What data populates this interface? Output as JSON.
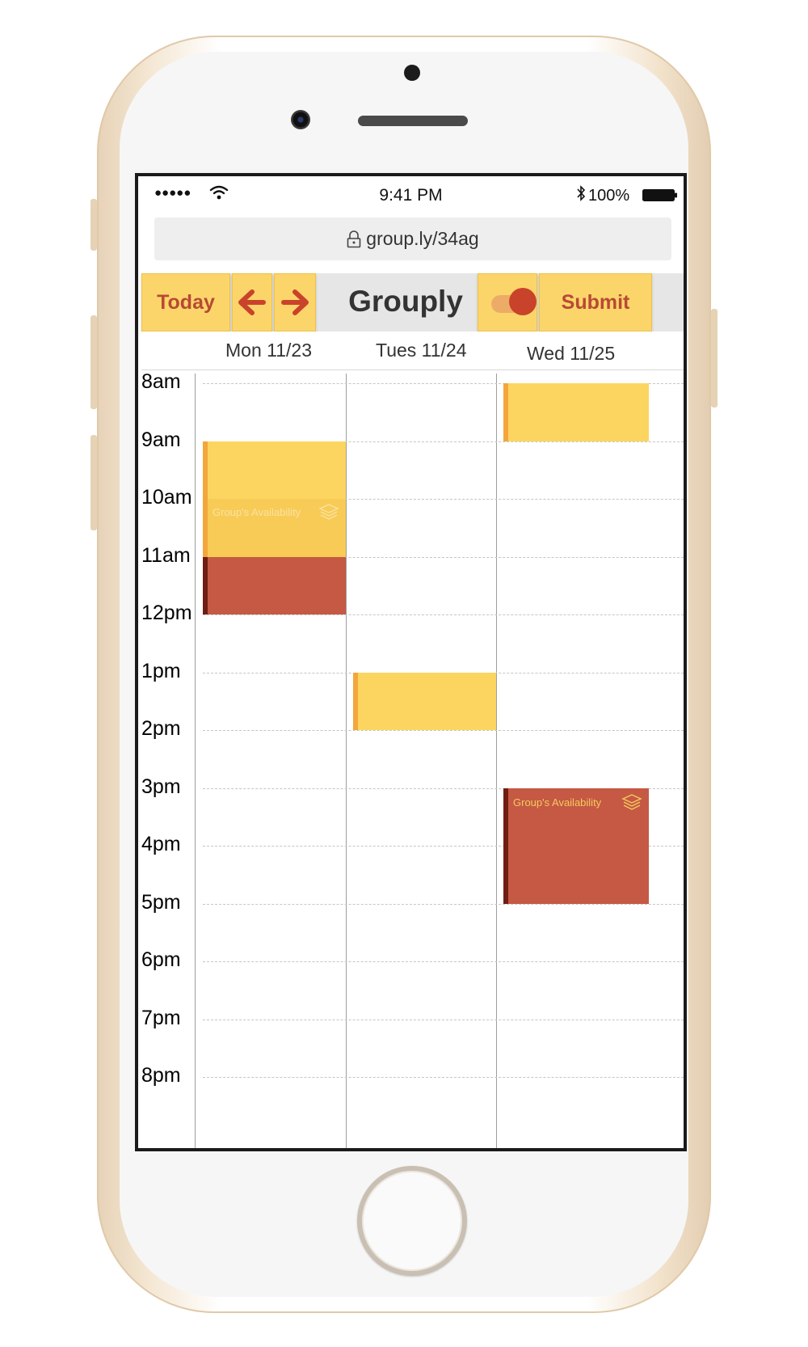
{
  "status_bar": {
    "signal": "●●●●●",
    "time": "9:41 PM",
    "battery": "100%"
  },
  "browser": {
    "url": "group.ly/34ag"
  },
  "toolbar": {
    "today_label": "Today",
    "brand": "Grouply",
    "submit_label": "Submit",
    "toggle_on": true
  },
  "calendar": {
    "days": [
      "Mon 11/23",
      "Tues 11/24",
      "Wed 11/25"
    ],
    "hours": [
      "8am",
      "9am",
      "10am",
      "11am",
      "12pm",
      "1pm",
      "2pm",
      "3pm",
      "4pm",
      "5pm",
      "6pm",
      "7pm",
      "8pm"
    ],
    "events": [
      {
        "day": "Mon 11/23",
        "start": "9am",
        "end": "11am",
        "kind": "availability",
        "label": "Group's Availability",
        "color": "#fcd560"
      },
      {
        "day": "Mon 11/23",
        "start": "11am",
        "end": "12pm",
        "kind": "selected",
        "color": "#c55944"
      },
      {
        "day": "Tues 11/24",
        "start": "1pm",
        "end": "2pm",
        "kind": "availability",
        "color": "#fcd560"
      },
      {
        "day": "Wed 11/25",
        "start": "8am",
        "end": "9am",
        "kind": "availability",
        "color": "#fcd560"
      },
      {
        "day": "Wed 11/25",
        "start": "3pm",
        "end": "5pm",
        "kind": "selected",
        "label": "Group's Availability",
        "color": "#c55944"
      }
    ]
  },
  "colors": {
    "accent_yellow": "#fcd56a",
    "accent_red": "#c9432b",
    "label_red": "#b74a34"
  }
}
